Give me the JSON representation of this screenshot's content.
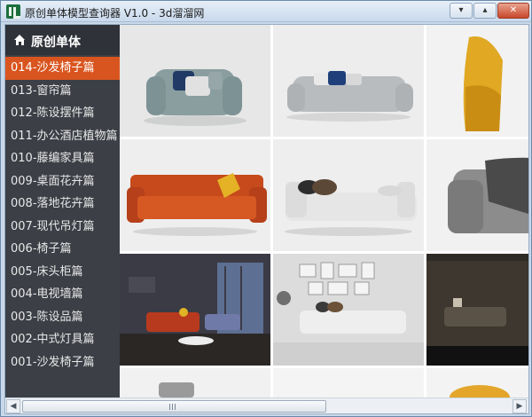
{
  "window": {
    "title": "原创单体模型查询器 V1.0 - 3d溜溜网",
    "minimize_glyph": "▾",
    "maximize_glyph": "▴",
    "close_glyph": "✕"
  },
  "sidebar": {
    "header": "原创单体",
    "items": [
      {
        "label": "014-沙发椅子篇",
        "active": true
      },
      {
        "label": "013-窗帘篇",
        "active": false
      },
      {
        "label": "012-陈设摆件篇",
        "active": false
      },
      {
        "label": "011-办公酒店植物篇",
        "active": false
      },
      {
        "label": "010-藤编家具篇",
        "active": false
      },
      {
        "label": "009-桌面花卉篇",
        "active": false
      },
      {
        "label": "008-落地花卉篇",
        "active": false
      },
      {
        "label": "007-现代吊灯篇",
        "active": false
      },
      {
        "label": "006-椅子篇",
        "active": false
      },
      {
        "label": "005-床头柜篇",
        "active": false
      },
      {
        "label": "004-电视墙篇",
        "active": false
      },
      {
        "label": "003-陈设品篇",
        "active": false
      },
      {
        "label": "002-中式灯具篇",
        "active": false
      },
      {
        "label": "001-沙发椅子篇",
        "active": false
      }
    ]
  },
  "thumbnails": [
    {
      "name": "teal-armchair",
      "subject": "armchair",
      "color": "#8a9ea0"
    },
    {
      "name": "grey-sofa",
      "subject": "sofa",
      "color": "#b8bcbf"
    },
    {
      "name": "yellow-lounge-chair",
      "subject": "chair",
      "color": "#e0a823"
    },
    {
      "name": "orange-sofa",
      "subject": "sofa",
      "color": "#c64a1b"
    },
    {
      "name": "white-daybed",
      "subject": "daybed",
      "color": "#e6e6e6"
    },
    {
      "name": "grey-chair-with-throw",
      "subject": "chair",
      "color": "#8c8c8c"
    },
    {
      "name": "living-room-dusk",
      "subject": "room",
      "color": "#3b3b46"
    },
    {
      "name": "white-sofa-gallery-wall",
      "subject": "room",
      "color": "#dcdcdc"
    },
    {
      "name": "dark-living-room",
      "subject": "room",
      "color": "#2e2a25"
    },
    {
      "name": "partial-grey-chair",
      "subject": "chair",
      "color": "#9a9a9a"
    },
    {
      "name": "partial-blank",
      "subject": "blank",
      "color": "#f4f4f4"
    },
    {
      "name": "partial-yellow-chair",
      "subject": "chair",
      "color": "#e3a62a"
    }
  ],
  "scrollbar": {
    "left_arrow": "◀",
    "right_arrow": "▶"
  },
  "colors": {
    "sidebar_bg": "#3c3f46",
    "active_item": "#d9551f",
    "title_bar": "#c9d9ec"
  }
}
